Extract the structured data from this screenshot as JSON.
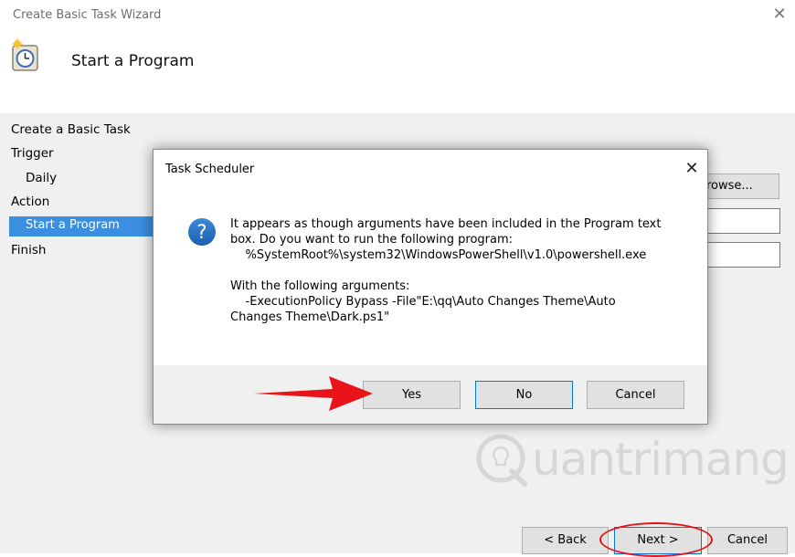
{
  "window": {
    "title": "Create Basic Task Wizard",
    "close_glyph": "✕",
    "heading": "Start a Program",
    "icon": "task-clock-icon"
  },
  "steps": [
    {
      "label": "Create a Basic Task"
    },
    {
      "label": "Trigger"
    },
    {
      "label": "Daily"
    },
    {
      "label": "Action"
    },
    {
      "label": "Start a Program",
      "selected": true
    },
    {
      "label": "Finish"
    }
  ],
  "action_panel": {
    "browse_label": "rowse..."
  },
  "footer": {
    "back_label": "< Back",
    "next_label": "Next >",
    "cancel_label": "Cancel"
  },
  "dialog": {
    "title": "Task Scheduler",
    "close_glyph": "✕",
    "icon": "question-icon",
    "message_lines": [
      "It appears as though arguments have been included in the Program text",
      "box. Do you want to run the following program:",
      "    %SystemRoot%\\system32\\WindowsPowerShell\\v1.0\\powershell.exe",
      "",
      "With the following arguments:",
      "    -ExecutionPolicy Bypass -File\"E:\\qq\\Auto Changes Theme\\Auto",
      "Changes Theme\\Dark.ps1\""
    ],
    "yes_label": "Yes",
    "no_label": "No",
    "cancel_label": "Cancel"
  },
  "watermark": {
    "text": "uantrimang"
  },
  "colors": {
    "selection": "#3b8fe0",
    "annotation_red": "#e8141a",
    "focus_blue": "#0078d7"
  }
}
